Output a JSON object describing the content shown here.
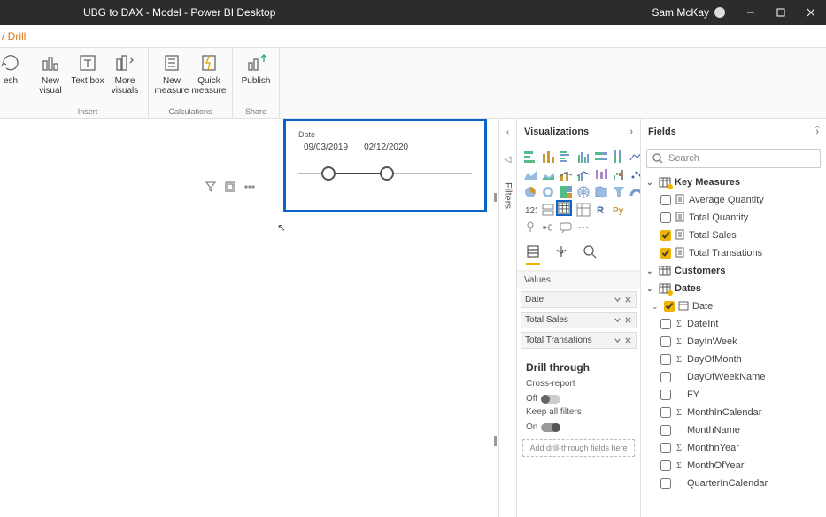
{
  "titlebar": {
    "title": "UBG to DAX - Model - Power BI Desktop",
    "user": "Sam McKay"
  },
  "subtab": {
    "label": "/ Drill"
  },
  "ribbon": {
    "refresh": "esh",
    "new_visual": "New visual",
    "text_box": "Text box",
    "more_visuals": "More visuals",
    "new_measure": "New measure",
    "quick_measure": "Quick measure",
    "publish": "Publish",
    "group_insert": "Insert",
    "group_calc": "Calculations",
    "group_share": "Share"
  },
  "slicer": {
    "label": "Date",
    "from": "09/03/2019",
    "to": "02/12/2020"
  },
  "filters": {
    "label": "Filters"
  },
  "vizpane": {
    "title": "Visualizations",
    "values_label": "Values",
    "wells": [
      "Date",
      "Total Sales",
      "Total Transations"
    ],
    "drill_title": "Drill through",
    "cross_report": "Cross-report",
    "off": "Off",
    "keep_filters": "Keep all filters",
    "on": "On",
    "drill_drop": "Add drill-through fields here"
  },
  "fieldspane": {
    "title": "Fields",
    "search_placeholder": "Search",
    "tables": {
      "key_measures": {
        "label": "Key Measures",
        "fields": [
          {
            "label": "Average Quantity",
            "checked": false,
            "calc": true
          },
          {
            "label": "Total Quantity",
            "checked": false,
            "calc": true
          },
          {
            "label": "Total Sales",
            "checked": true,
            "calc": true
          },
          {
            "label": "Total Transations",
            "checked": true,
            "calc": true
          }
        ]
      },
      "customers": {
        "label": "Customers"
      },
      "dates": {
        "label": "Dates",
        "fields": [
          {
            "label": "Date",
            "checked": true,
            "calc": true
          },
          {
            "label": "DateInt",
            "checked": false,
            "sigma": true
          },
          {
            "label": "DayInWeek",
            "checked": false,
            "sigma": true
          },
          {
            "label": "DayOfMonth",
            "checked": false,
            "sigma": true
          },
          {
            "label": "DayOfWeekName",
            "checked": false
          },
          {
            "label": "FY",
            "checked": false
          },
          {
            "label": "MonthInCalendar",
            "checked": false,
            "sigma": true
          },
          {
            "label": "MonthName",
            "checked": false
          },
          {
            "label": "MonthnYear",
            "checked": false,
            "sigma": true
          },
          {
            "label": "MonthOfYear",
            "checked": false,
            "sigma": true
          },
          {
            "label": "QuarterInCalendar",
            "checked": false
          }
        ]
      }
    }
  }
}
